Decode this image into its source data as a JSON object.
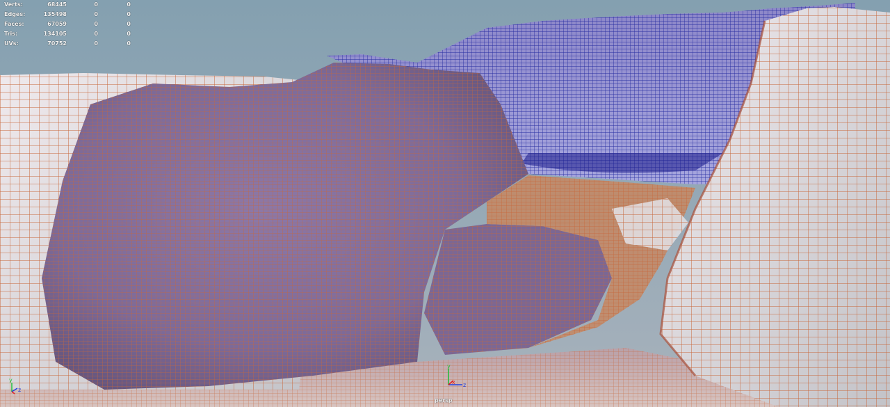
{
  "stats": [
    {
      "label": "Verts:",
      "total": "68445",
      "selected": "0",
      "component": "0"
    },
    {
      "label": "Edges:",
      "total": "135498",
      "selected": "0",
      "component": "0"
    },
    {
      "label": "Faces:",
      "total": "67059",
      "selected": "0",
      "component": "0"
    },
    {
      "label": "Tris:",
      "total": "134105",
      "selected": "0",
      "component": "0"
    },
    {
      "label": "UVs:",
      "total": "70752",
      "selected": "0",
      "component": "0"
    }
  ],
  "camera": {
    "name": "persp"
  },
  "axes": {
    "y": "y",
    "x": "x",
    "z": "z"
  },
  "colors": {
    "sky": "#8e9fad",
    "wire_orange": "#c8683c",
    "wire_blue": "#161e9a",
    "rock_purple": "#8e7aa8",
    "rock_white": "#ebe7ea",
    "axis_x": "#e02020",
    "axis_y": "#20c040",
    "axis_z": "#2040e0"
  }
}
